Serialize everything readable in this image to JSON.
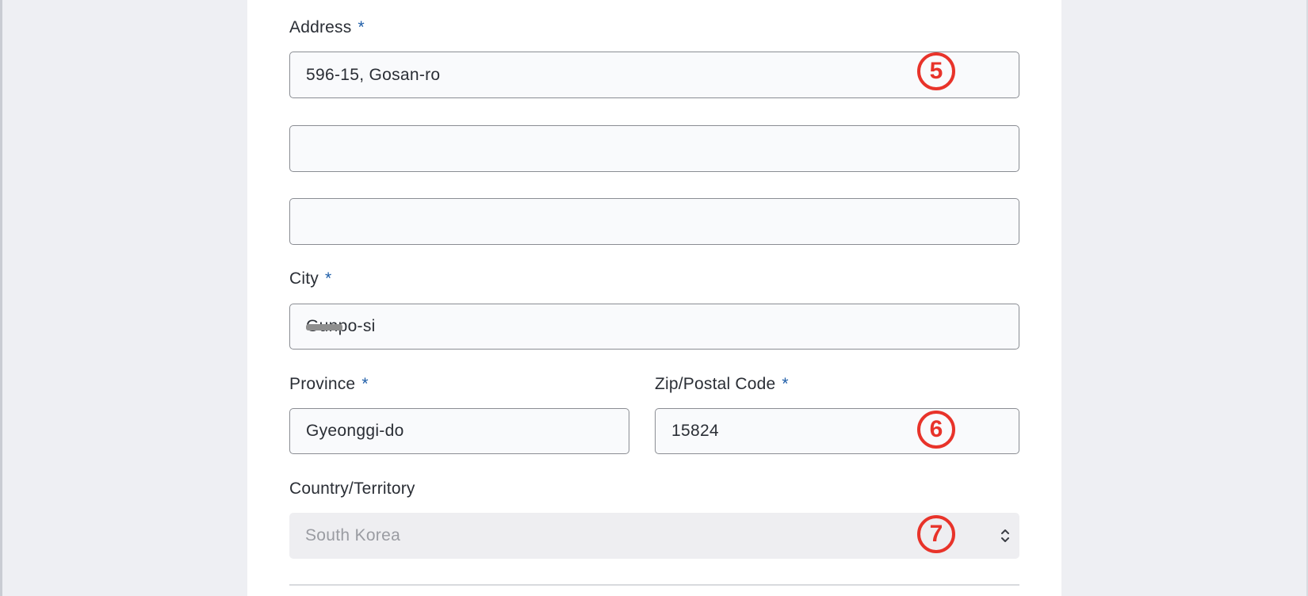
{
  "form": {
    "address": {
      "label": "Address",
      "required_mark": "*",
      "line1_value": "596-15, Gosan-ro",
      "line2_value": "",
      "line3_value": ""
    },
    "city": {
      "label": "City",
      "required_mark": "*",
      "value": "Gunpo-si"
    },
    "province": {
      "label": "Province",
      "required_mark": "*",
      "value": "Gyeonggi-do"
    },
    "zip": {
      "label": "Zip/Postal Code",
      "required_mark": "*",
      "value": "15824"
    },
    "country": {
      "label": "Country/Territory",
      "selected": "South Korea",
      "icon": "chevron-up-down-icon"
    }
  },
  "annotations": {
    "marker_5": "5",
    "marker_6": "6",
    "marker_7": "7",
    "color": "#e8332a"
  },
  "colors": {
    "required_accent": "#1f5ea8",
    "page_background": "#eeeff3",
    "card_background": "#ffffff"
  }
}
